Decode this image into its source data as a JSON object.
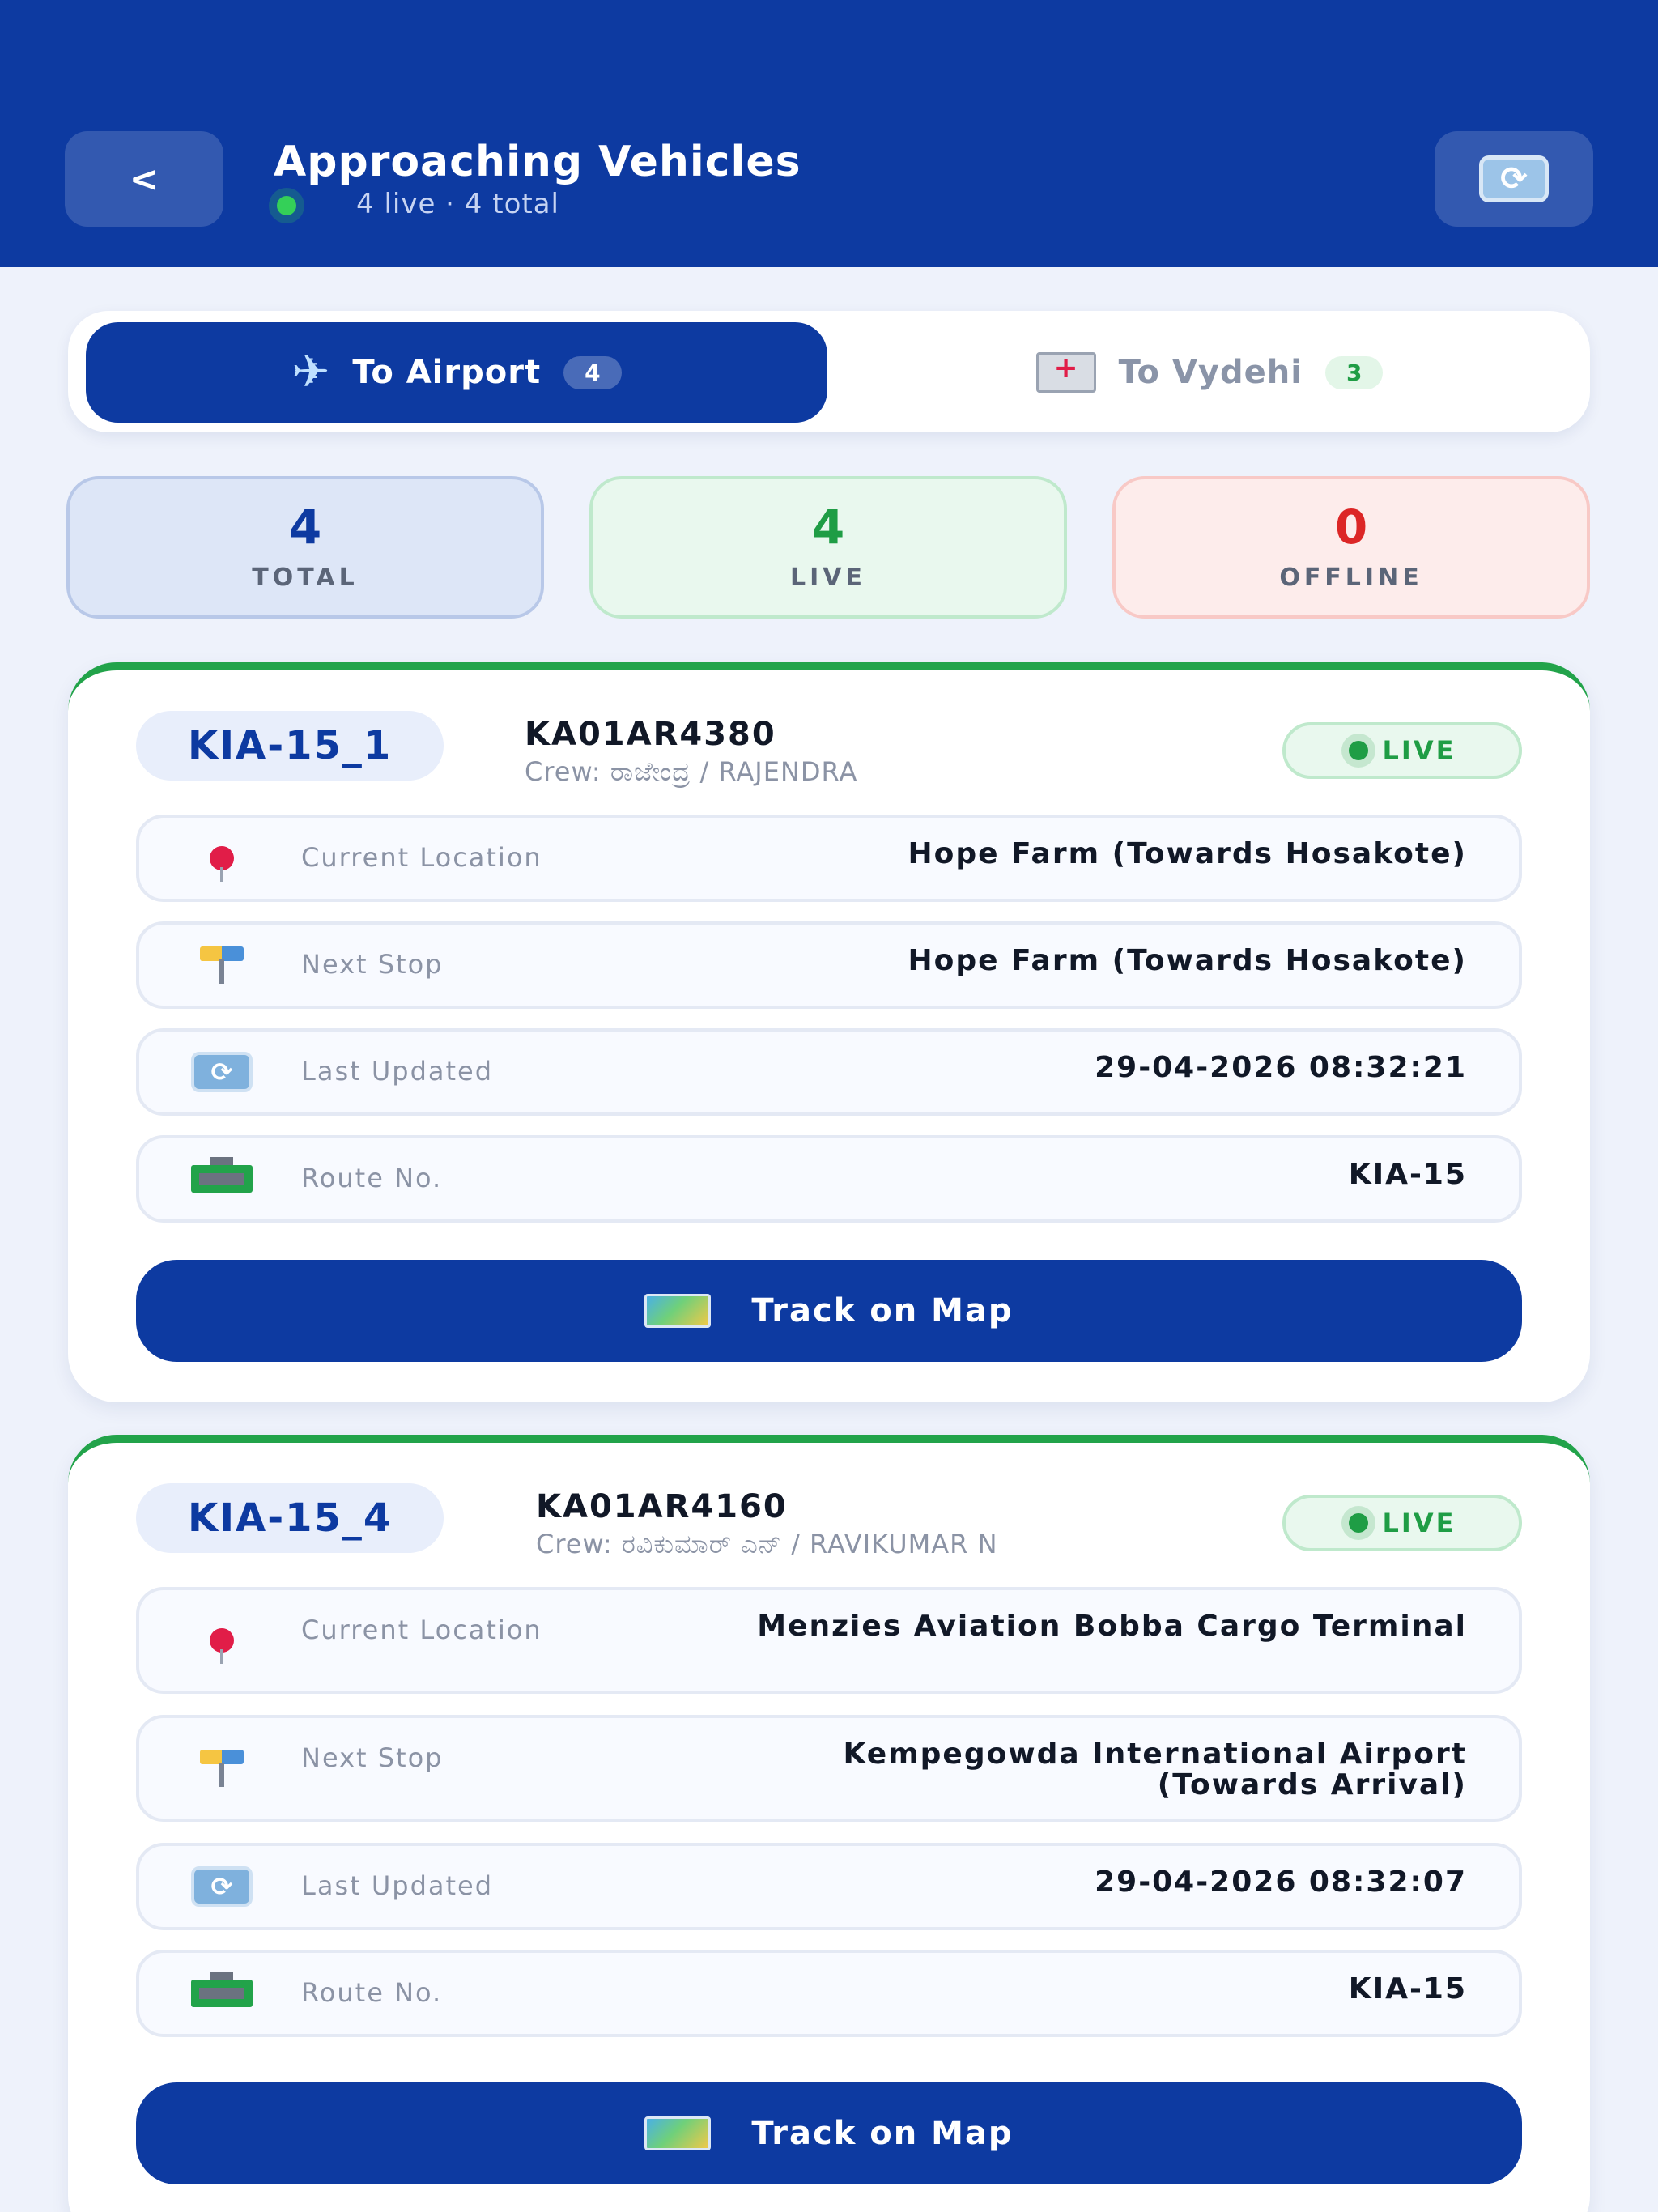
{
  "header": {
    "back_label": "<",
    "title": "Approaching Vehicles",
    "subtitle": "4 live · 4 total"
  },
  "tabs": [
    {
      "label": "To Airport",
      "count": "4",
      "icon": "airplane-icon",
      "active": true
    },
    {
      "label": "To Vydehi",
      "count": "3",
      "icon": "hospital-icon",
      "active": false
    }
  ],
  "stats": {
    "total": {
      "value": "4",
      "label": "TOTAL"
    },
    "live": {
      "value": "4",
      "label": "LIVE"
    },
    "offline": {
      "value": "0",
      "label": "OFFLINE"
    }
  },
  "labels": {
    "current_location": "Current Location",
    "next_stop": "Next Stop",
    "last_updated": "Last Updated",
    "route_no": "Route No.",
    "track": "Track on Map",
    "live": "LIVE"
  },
  "vehicles": [
    {
      "route_chip": "KIA-15_1",
      "plate": "KA01AR4380",
      "crew": "Crew: ರಾಜೇಂದ್ರ / RAJENDRA",
      "current_location": "Hope Farm (Towards Hosakote)",
      "next_stop": "Hope Farm (Towards Hosakote)",
      "last_updated": "29-04-2026 08:32:21",
      "route_no": "KIA-15"
    },
    {
      "route_chip": "KIA-15_4",
      "plate": "KA01AR4160",
      "crew": "Crew: ರವಿಕುಮಾರ್ ಎನ್ / RAVIKUMAR N",
      "current_location": "Menzies Aviation Bobba Cargo Terminal",
      "next_stop": "Kempegowda International Airport (Towards Arrival)",
      "last_updated": "29-04-2026 08:32:07",
      "route_no": "KIA-15"
    }
  ],
  "colors": {
    "primary": "#0d3aa1",
    "live_green": "#1f9d45",
    "offline_red": "#dc2626",
    "background": "#eef2fb"
  }
}
